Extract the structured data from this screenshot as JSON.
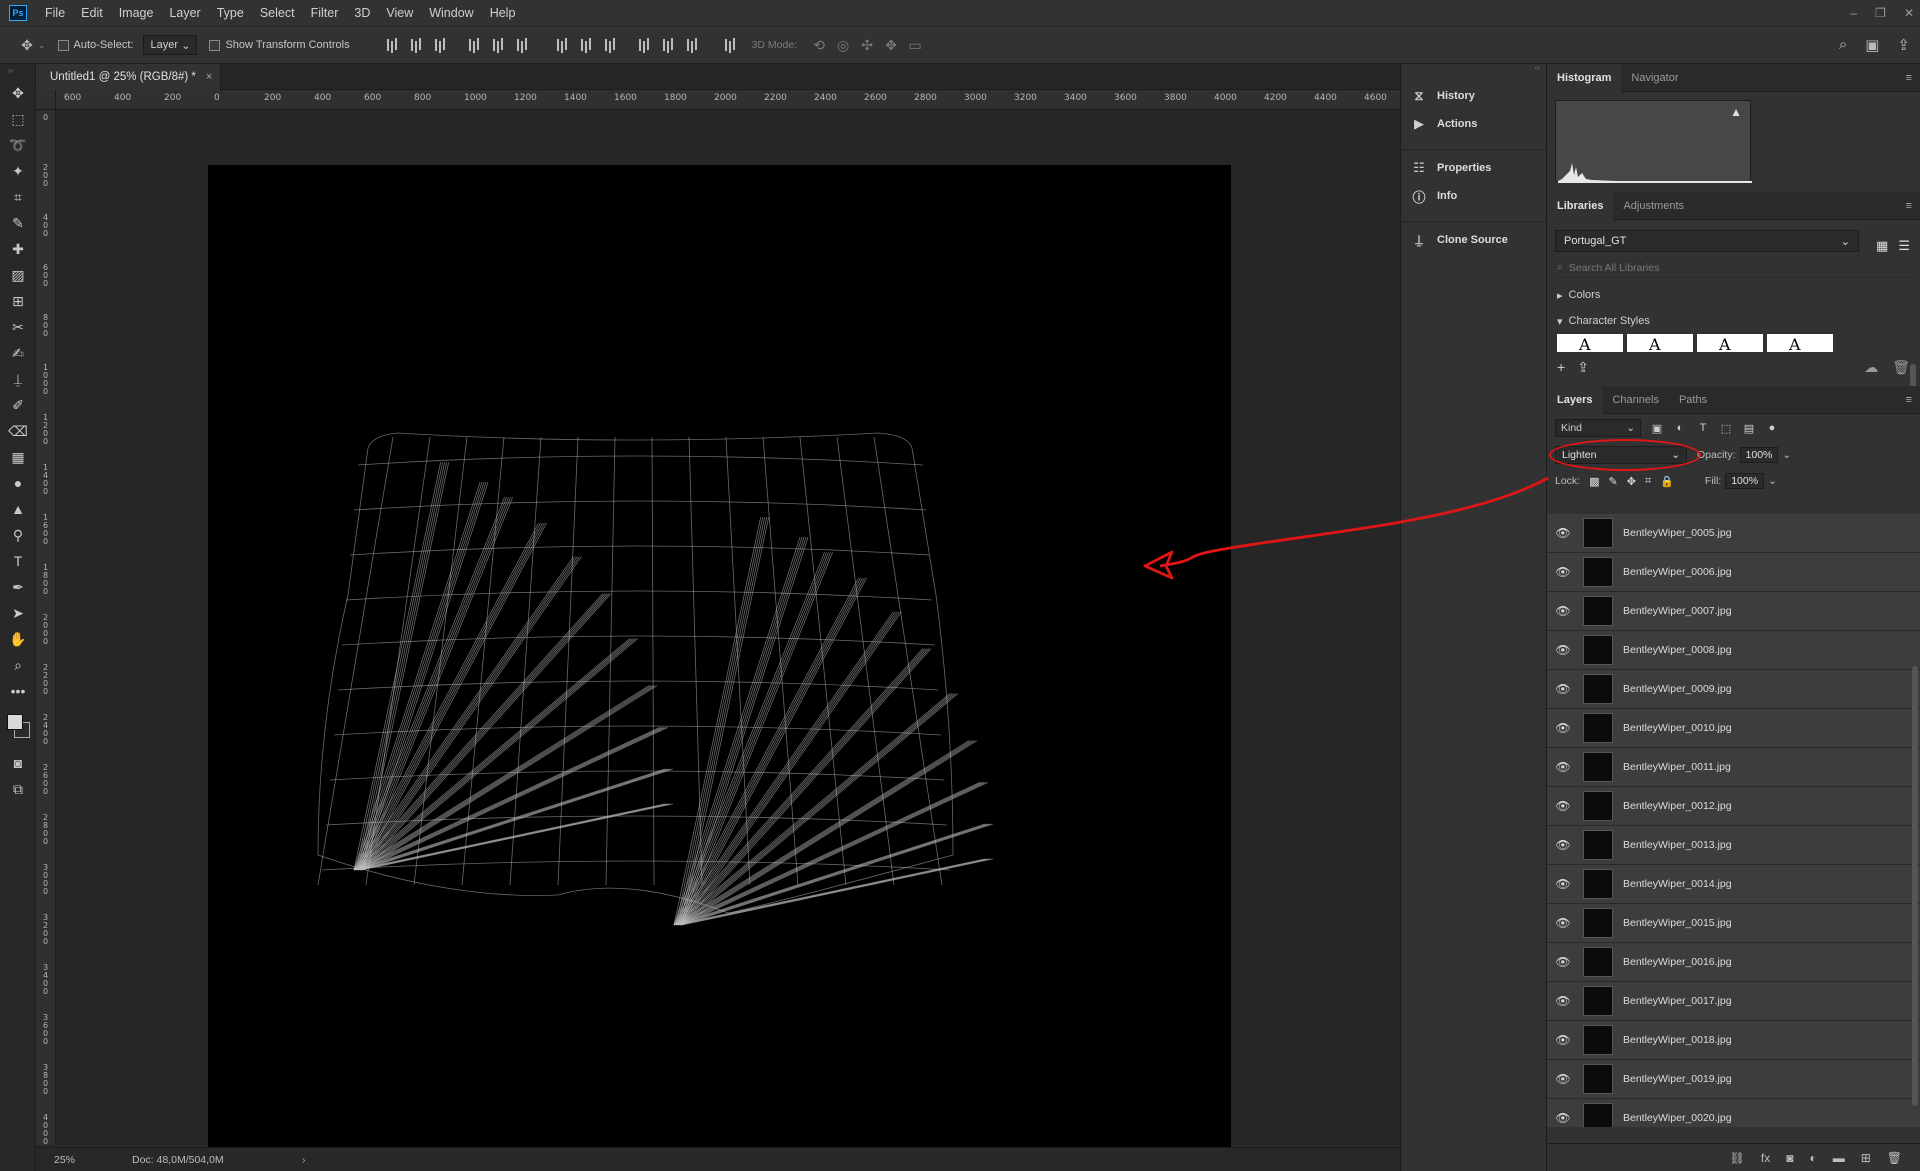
{
  "app": {
    "logo": "Ps"
  },
  "menu": [
    "File",
    "Edit",
    "Image",
    "Layer",
    "Type",
    "Select",
    "Filter",
    "3D",
    "View",
    "Window",
    "Help"
  ],
  "window_controls": {
    "minimize": "–",
    "restore": "❐",
    "close": "✕"
  },
  "options_bar": {
    "auto_select_label": "Auto-Select:",
    "auto_select_target": "Layer",
    "show_transform_label": "Show Transform Controls",
    "mode_3d_label": "3D Mode:"
  },
  "document": {
    "tab_title": "Untitled1 @ 25% (RGB/8#) *",
    "close": "×",
    "ruler_top": [
      "600",
      "400",
      "200",
      "0",
      "200",
      "400",
      "600",
      "800",
      "1000",
      "1200",
      "1400",
      "1600",
      "1800",
      "2000",
      "2200",
      "2400",
      "2600",
      "2800",
      "3000",
      "3200",
      "3400",
      "3600",
      "3800",
      "4000",
      "4200",
      "4400",
      "4600"
    ],
    "ruler_left": [
      "0",
      "2 0 0",
      "4 0 0",
      "6 0 0",
      "8 0 0",
      "1 0 0 0",
      "1 2 0 0",
      "1 4 0 0",
      "1 6 0 0",
      "1 8 0 0",
      "2 0 0 0",
      "2 2 0 0",
      "2 4 0 0",
      "2 6 0 0",
      "2 8 0 0",
      "3 0 0 0",
      "3 2 0 0",
      "3 4 0 0",
      "3 6 0 0",
      "3 8 0 0",
      "4 0 0 0"
    ]
  },
  "status": {
    "zoom": "25%",
    "doc_info": "Doc: 48,0M/504,0M",
    "chevron": "›"
  },
  "dock": [
    {
      "label": "History",
      "icon": "history-icon"
    },
    {
      "label": "Actions",
      "icon": "play-icon"
    },
    {
      "label": "Properties",
      "icon": "properties-icon"
    },
    {
      "label": "Info",
      "icon": "info-icon"
    },
    {
      "label": "Clone Source",
      "icon": "clone-source-icon"
    }
  ],
  "histogram_panel": {
    "tabs": [
      "Histogram",
      "Navigator"
    ]
  },
  "libraries_panel": {
    "tabs": [
      "Libraries",
      "Adjustments"
    ],
    "library_name": "Portugal_GT",
    "search_placeholder": "Search All Libraries",
    "sections": [
      "Colors",
      "Character Styles"
    ],
    "char_style_sample": "A"
  },
  "layers_panel": {
    "tabs": [
      "Layers",
      "Channels",
      "Paths"
    ],
    "kind": "Kind",
    "blend_mode": "Lighten",
    "opacity_label": "Opacity:",
    "opacity": "100%",
    "lock_label": "Lock:",
    "fill_label": "Fill:",
    "fill": "100%",
    "layers": [
      "BentleyWiper_0005.jpg",
      "BentleyWiper_0006.jpg",
      "BentleyWiper_0007.jpg",
      "BentleyWiper_0008.jpg",
      "BentleyWiper_0009.jpg",
      "BentleyWiper_0010.jpg",
      "BentleyWiper_0011.jpg",
      "BentleyWiper_0012.jpg",
      "BentleyWiper_0013.jpg",
      "BentleyWiper_0014.jpg",
      "BentleyWiper_0015.jpg",
      "BentleyWiper_0016.jpg",
      "BentleyWiper_0017.jpg",
      "BentleyWiper_0018.jpg",
      "BentleyWiper_0019.jpg",
      "BentleyWiper_0020.jpg"
    ]
  },
  "colors": {
    "annotation": "#e01616",
    "canvas": "#000000",
    "accent": "#31a8ff"
  }
}
